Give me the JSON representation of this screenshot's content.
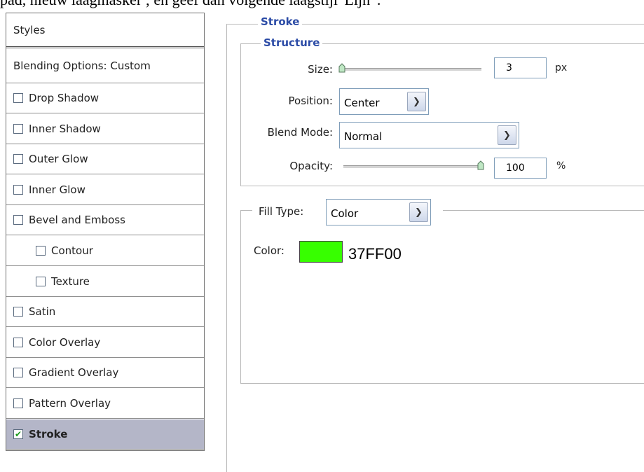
{
  "caption": "pad, nieuw laagmasker ; en geef dan volgende laagstijl 'Lijn' :",
  "styles": {
    "header": "Styles",
    "blending": "Blending Options: Custom",
    "items": [
      {
        "label": "Drop Shadow",
        "checked": false,
        "sub": false
      },
      {
        "label": "Inner Shadow",
        "checked": false,
        "sub": false
      },
      {
        "label": "Outer Glow",
        "checked": false,
        "sub": false
      },
      {
        "label": "Inner Glow",
        "checked": false,
        "sub": false
      },
      {
        "label": "Bevel and Emboss",
        "checked": false,
        "sub": false
      },
      {
        "label": "Contour",
        "checked": false,
        "sub": true
      },
      {
        "label": "Texture",
        "checked": false,
        "sub": true
      },
      {
        "label": "Satin",
        "checked": false,
        "sub": false
      },
      {
        "label": "Color Overlay",
        "checked": false,
        "sub": false
      },
      {
        "label": "Gradient Overlay",
        "checked": false,
        "sub": false
      },
      {
        "label": "Pattern Overlay",
        "checked": false,
        "sub": false
      },
      {
        "label": "Stroke",
        "checked": true,
        "sub": false,
        "selected": true
      }
    ]
  },
  "stroke": {
    "legend": "Stroke",
    "structure": {
      "legend": "Structure",
      "size_label": "Size:",
      "size_value": "3",
      "size_unit": "px",
      "size_slider_fraction": 0.0,
      "position_label": "Position:",
      "position_value": "Center",
      "blend_label": "Blend Mode:",
      "blend_value": "Normal",
      "opacity_label": "Opacity:",
      "opacity_value": "100",
      "opacity_unit": "%",
      "opacity_slider_fraction": 1.0
    },
    "fill": {
      "fill_type_label": "Fill Type:",
      "fill_type_value": "Color",
      "color_label": "Color:",
      "color_hex": "37FF00",
      "swatch_color": "#37ff00"
    }
  }
}
